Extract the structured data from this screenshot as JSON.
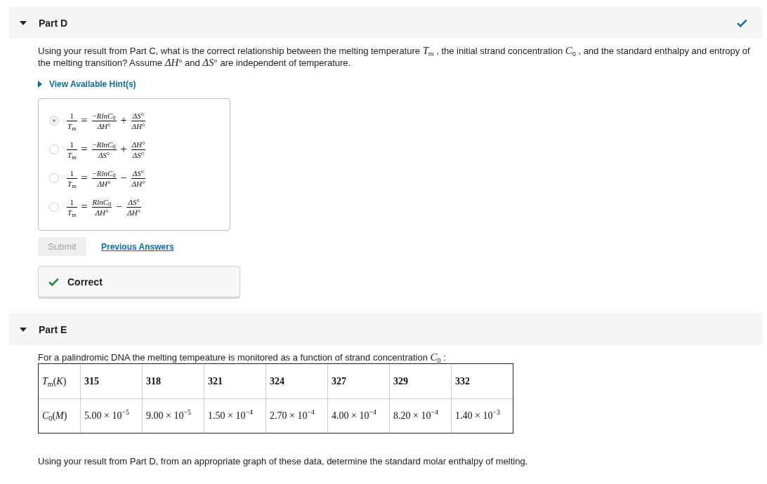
{
  "parts": [
    {
      "title": "Part D",
      "expanded": true,
      "correct": true,
      "question": "Using your result from Part C, what is the correct relationship between the melting temperature *T*$_{m}$ , the initial strand concentration *C*$_{0}$ , and the standard enthalpy and entropy of the melting transition? Assume *ΔH*° and *ΔS*° are independent of temperature.",
      "hint": {
        "label": "View Available Hint(s)",
        "expanded": false
      },
      "choices": [
        {
          "selected": true,
          "lhs": {
            "numerator": "1",
            "denominator": "*T*$_{m}$"
          },
          "relation": "=",
          "term_1": {
            "numerator": "−*RlnC*$_{0}$",
            "denominator": "*ΔH*°"
          },
          "operator": "+",
          "term_2": {
            "numerator": "*ΔS*°",
            "denominator": "*ΔH*°"
          }
        },
        {
          "selected": false,
          "lhs": {
            "numerator": "1",
            "denominator": "*T*$_{m}$"
          },
          "relation": "=",
          "term_1": {
            "numerator": "−*RlnC*$_{0}$",
            "denominator": "*ΔS*°"
          },
          "operator": "+",
          "term_2": {
            "numerator": "*ΔH*°",
            "denominator": "*ΔS*°"
          }
        },
        {
          "selected": false,
          "lhs": {
            "numerator": "1",
            "denominator": "*T*$_{m}$"
          },
          "relation": "=",
          "term_1": {
            "numerator": "−*RlnC*$_{0}$",
            "denominator": "*ΔH*°"
          },
          "operator": "−",
          "term_2": {
            "numerator": "*ΔS*°",
            "denominator": "*ΔH*°"
          }
        },
        {
          "selected": false,
          "lhs": {
            "numerator": "1",
            "denominator": "*T*$_{m}$"
          },
          "relation": "=",
          "term_1": {
            "numerator": "*RlnC*$_{0}$",
            "denominator": "*ΔH*°"
          },
          "operator": "−",
          "term_2": {
            "numerator": "*ΔS*°",
            "denominator": "*ΔH*°"
          }
        }
      ],
      "submit": {
        "label": "Submit",
        "disabled": true
      },
      "previous_answers": "Previous Answers",
      "feedback": {
        "kind": "correct",
        "label": "Correct"
      }
    },
    {
      "title": "Part E",
      "expanded": true,
      "correct": false,
      "intro": "For a palindromic DNA the melting tempeature is monitored as a function of strand concentration *C*$_{0}$ :",
      "table": {
        "rows": [
          {
            "kind": "header",
            "label": "*T*$_{m}$(*K*)",
            "cells": [
              "315",
              "318",
              "321",
              "324",
              "327",
              "329",
              "332"
            ]
          },
          {
            "kind": "data",
            "label": "*C*$_{0}$(*M*)",
            "cells": [
              "5.00 × 10$^{−5}$",
              "9.00 × 10$^{−5}$",
              "1.50 × 10$^{−4}$",
              "2.70 × 10$^{−4}$",
              "4.00 × 10$^{−4}$",
              "8.20 × 10$^{−4}$",
              "1.40 × 10$^{−3}$"
            ]
          }
        ]
      },
      "question": "Using your result from Part D, from an appropriate graph of these data, determine the standard molar enthalpy of melting."
    }
  ]
}
